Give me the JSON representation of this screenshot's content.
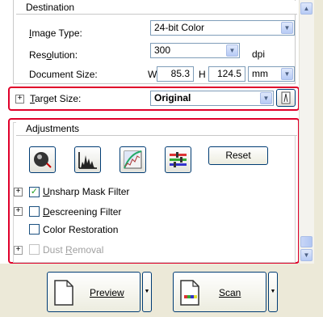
{
  "destination": {
    "title": "Destination",
    "image_type_label": "Image Type:",
    "image_type_value": "24-bit Color",
    "resolution_label": "Resolution:",
    "resolution_value": "300",
    "resolution_unit": "dpi",
    "document_size_label": "Document Size:",
    "width_label": "W",
    "width_value": "85.3",
    "height_label": "H",
    "height_value": "124.5",
    "size_unit": "mm",
    "target_size_label": "Target Size:",
    "target_size_value": "Original"
  },
  "adjustments": {
    "title": "Adjustments",
    "reset_label": "Reset",
    "unsharp_mask_label": "Unsharp Mask Filter",
    "unsharp_mask_checked": true,
    "descreening_label": "Descreening Filter",
    "descreening_checked": false,
    "color_restoration_label": "Color Restoration",
    "color_restoration_checked": false,
    "dust_removal_label": "Dust Removal",
    "dust_removal_checked": false
  },
  "actions": {
    "preview_label": "Preview",
    "scan_label": "Scan"
  },
  "icons": {
    "expand": "plus-icon",
    "dropdown": "chevron-down-icon",
    "orientation": "orientation-icon",
    "auto_exposure": "auto-exposure-icon",
    "histogram": "histogram-icon",
    "tone_correction": "tone-curve-icon",
    "color_palette": "color-palette-icon"
  },
  "colors": {
    "highlight": "#e0002a"
  }
}
